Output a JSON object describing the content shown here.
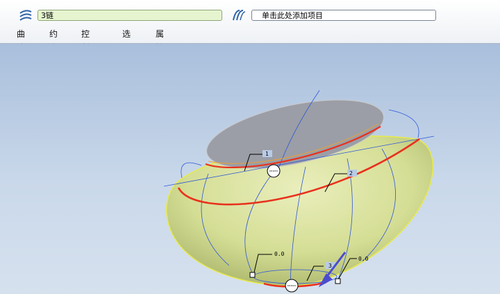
{
  "dashboard": {
    "collector_value": "3链",
    "add_item_placeholder": "单击此处添加项目",
    "tabs": [
      "曲线",
      "约束",
      "控制点",
      "选项",
      "属性"
    ]
  },
  "viewport": {
    "tags": [
      "1",
      "2",
      "3",
      "0.0",
      "0.0"
    ],
    "colors": {
      "surface": "#d9e29a",
      "top_face": "#9b9ea6",
      "chain": "#e8321e",
      "edge_yellow": "#f2f04a",
      "control_blue": "#2f56d9",
      "arrow": "#4b4ccf"
    }
  }
}
